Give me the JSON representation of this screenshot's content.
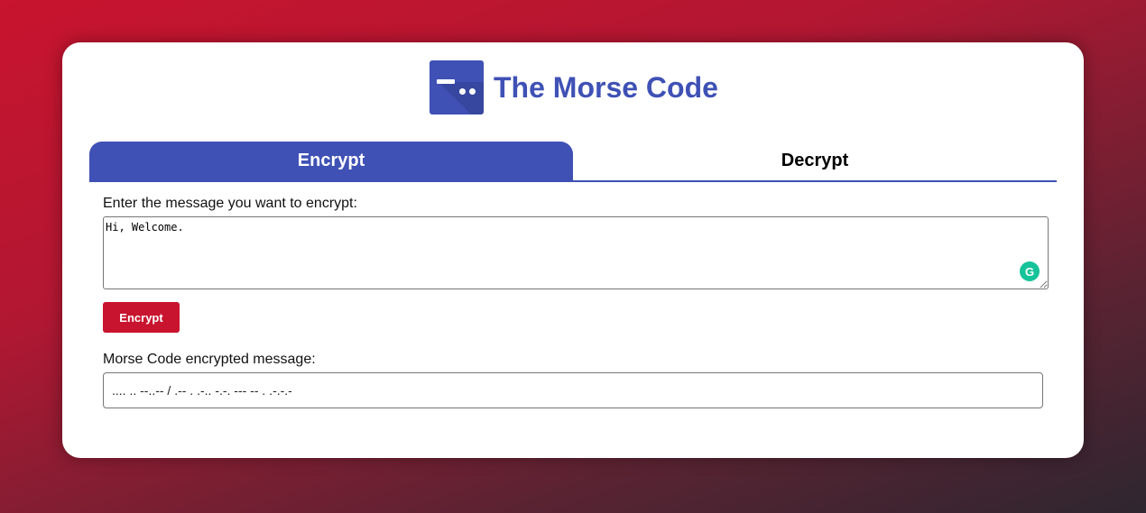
{
  "app": {
    "title": "The Morse Code",
    "logo_icon": "morse-logo-icon"
  },
  "tabs": [
    {
      "label": "Encrypt",
      "active": true
    },
    {
      "label": "Decrypt",
      "active": false
    }
  ],
  "encrypt": {
    "input_label": "Enter the message you want to encrypt:",
    "input_value": "Hi, Welcome.",
    "button_label": "Encrypt",
    "output_label": "Morse Code encrypted message:",
    "output_value": ".... .. --..-- / .-- . .-.. -.-. --- -- . .-.-.-"
  },
  "colors": {
    "primary": "#3f51b5",
    "accent": "#c8142e",
    "grammarly": "#15c39a"
  }
}
